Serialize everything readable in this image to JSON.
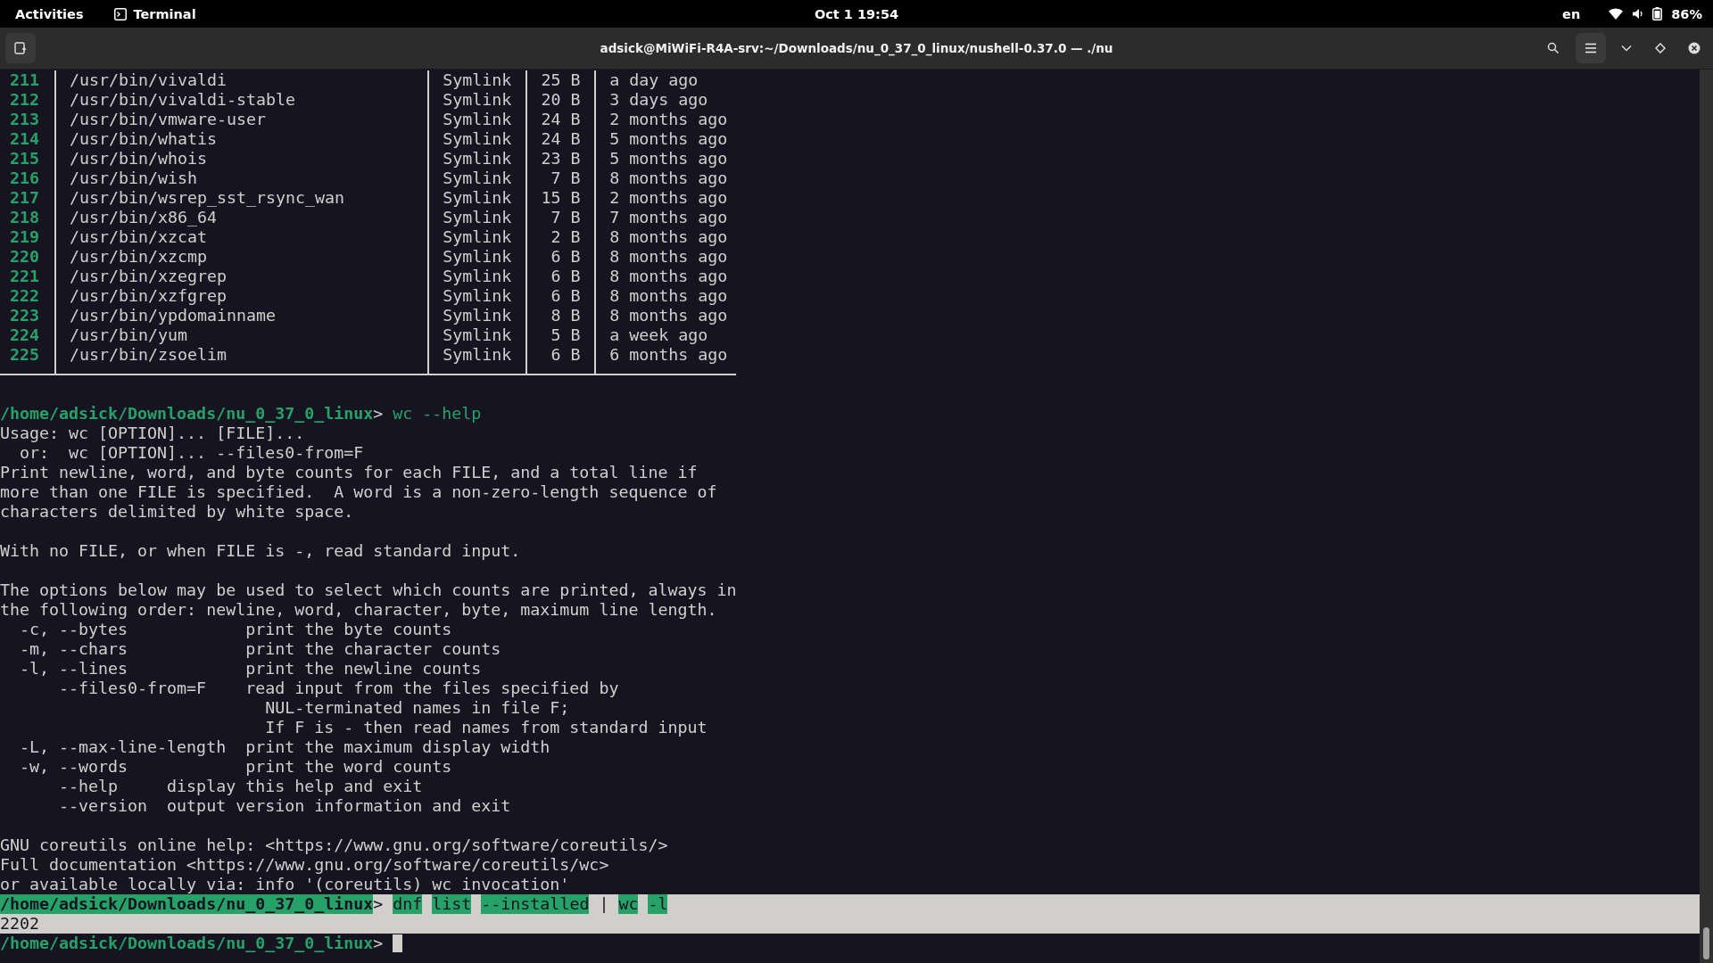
{
  "top_bar": {
    "activities": "Activities",
    "app_name": "Terminal",
    "clock": "Oct 1  19:54",
    "keyboard_layout": "en",
    "battery_percent": "86%"
  },
  "window": {
    "title": "adsick@MiWiFi-R4A-srv:~/Downloads/nu_0_37_0_linux/nushell-0.37.0 — ./nu"
  },
  "table": {
    "rows": [
      {
        "cells": [
          "211",
          "/usr/bin/vivaldi",
          "Symlink",
          "25 B",
          "a day ago"
        ]
      },
      {
        "cells": [
          "212",
          "/usr/bin/vivaldi-stable",
          "Symlink",
          "20 B",
          "3 days ago"
        ]
      },
      {
        "cells": [
          "213",
          "/usr/bin/vmware-user",
          "Symlink",
          "24 B",
          "2 months ago"
        ]
      },
      {
        "cells": [
          "214",
          "/usr/bin/whatis",
          "Symlink",
          "24 B",
          "5 months ago"
        ]
      },
      {
        "cells": [
          "215",
          "/usr/bin/whois",
          "Symlink",
          "23 B",
          "5 months ago"
        ]
      },
      {
        "cells": [
          "216",
          "/usr/bin/wish",
          "Symlink",
          "7 B",
          "8 months ago"
        ]
      },
      {
        "cells": [
          "217",
          "/usr/bin/wsrep_sst_rsync_wan",
          "Symlink",
          "15 B",
          "2 months ago"
        ]
      },
      {
        "cells": [
          "218",
          "/usr/bin/x86_64",
          "Symlink",
          "7 B",
          "7 months ago"
        ]
      },
      {
        "cells": [
          "219",
          "/usr/bin/xzcat",
          "Symlink",
          "2 B",
          "8 months ago"
        ]
      },
      {
        "cells": [
          "220",
          "/usr/bin/xzcmp",
          "Symlink",
          "6 B",
          "8 months ago"
        ]
      },
      {
        "cells": [
          "221",
          "/usr/bin/xzegrep",
          "Symlink",
          "6 B",
          "8 months ago"
        ]
      },
      {
        "cells": [
          "222",
          "/usr/bin/xzfgrep",
          "Symlink",
          "6 B",
          "8 months ago"
        ]
      },
      {
        "cells": [
          "223",
          "/usr/bin/ypdomainname",
          "Symlink",
          "8 B",
          "8 months ago"
        ]
      },
      {
        "cells": [
          "224",
          "/usr/bin/yum",
          "Symlink",
          "5 B",
          "a week ago"
        ]
      },
      {
        "cells": [
          "225",
          "/usr/bin/zsoelim",
          "Symlink",
          "6 B",
          "6 months ago"
        ]
      }
    ]
  },
  "lines": [
    {
      "kind": "blank"
    },
    {
      "kind": "prompt",
      "path": "/home/adsick/Downloads/nu_0_37_0_linux",
      "symbol": ">",
      "selected": false,
      "cursor": false,
      "tokens": [
        {
          "kind": "word",
          "text": "wc"
        },
        {
          "kind": "word",
          "text": "--help"
        }
      ]
    },
    {
      "kind": "text",
      "selected": false,
      "text": "Usage: wc [OPTION]... [FILE]..."
    },
    {
      "kind": "text",
      "selected": false,
      "text": "  or:  wc [OPTION]... --files0-from=F"
    },
    {
      "kind": "text",
      "selected": false,
      "text": "Print newline, word, and byte counts for each FILE, and a total line if"
    },
    {
      "kind": "text",
      "selected": false,
      "text": "more than one FILE is specified.  A word is a non-zero-length sequence of"
    },
    {
      "kind": "text",
      "selected": false,
      "text": "characters delimited by white space."
    },
    {
      "kind": "blank"
    },
    {
      "kind": "text",
      "selected": false,
      "text": "With no FILE, or when FILE is -, read standard input."
    },
    {
      "kind": "blank"
    },
    {
      "kind": "text",
      "selected": false,
      "text": "The options below may be used to select which counts are printed, always in"
    },
    {
      "kind": "text",
      "selected": false,
      "text": "the following order: newline, word, character, byte, maximum line length."
    },
    {
      "kind": "text",
      "selected": false,
      "text": "  -c, --bytes            print the byte counts"
    },
    {
      "kind": "text",
      "selected": false,
      "text": "  -m, --chars            print the character counts"
    },
    {
      "kind": "text",
      "selected": false,
      "text": "  -l, --lines            print the newline counts"
    },
    {
      "kind": "text",
      "selected": false,
      "text": "      --files0-from=F    read input from the files specified by"
    },
    {
      "kind": "text",
      "selected": false,
      "text": "                           NUL-terminated names in file F;"
    },
    {
      "kind": "text",
      "selected": false,
      "text": "                           If F is - then read names from standard input"
    },
    {
      "kind": "text",
      "selected": false,
      "text": "  -L, --max-line-length  print the maximum display width"
    },
    {
      "kind": "text",
      "selected": false,
      "text": "  -w, --words            print the word counts"
    },
    {
      "kind": "text",
      "selected": false,
      "text": "      --help     display this help and exit"
    },
    {
      "kind": "text",
      "selected": false,
      "text": "      --version  output version information and exit"
    },
    {
      "kind": "blank"
    },
    {
      "kind": "text",
      "selected": false,
      "text": "GNU coreutils online help: <https://www.gnu.org/software/coreutils/>"
    },
    {
      "kind": "text",
      "selected": false,
      "text": "Full documentation <https://www.gnu.org/software/coreutils/wc>"
    },
    {
      "kind": "text",
      "selected": false,
      "text": "or available locally via: info '(coreutils) wc invocation'"
    },
    {
      "kind": "prompt",
      "path": "/home/adsick/Downloads/nu_0_37_0_linux",
      "symbol": ">",
      "selected": true,
      "cursor": false,
      "tokens": [
        {
          "kind": "word",
          "text": "dnf"
        },
        {
          "kind": "word",
          "text": "list"
        },
        {
          "kind": "word",
          "text": "--installed"
        },
        {
          "kind": "pipe",
          "text": "|"
        },
        {
          "kind": "word",
          "text": "wc"
        },
        {
          "kind": "word",
          "text": "-l"
        }
      ]
    },
    {
      "kind": "text",
      "selected": true,
      "text": "2202"
    },
    {
      "kind": "prompt",
      "path": "/home/adsick/Downloads/nu_0_37_0_linux",
      "symbol": ">",
      "selected": false,
      "cursor": true
    }
  ]
}
